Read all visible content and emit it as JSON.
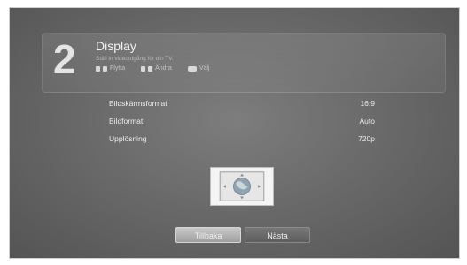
{
  "header": {
    "step_number": "2",
    "title": "Display",
    "subtitle": "Ställ in videoutgång för din TV.",
    "hints": {
      "move_label": "Flytta",
      "change_label": "Ändra",
      "select_label": "Välj"
    }
  },
  "settings": [
    {
      "label": "Bildskärmsformat",
      "value": "16:9"
    },
    {
      "label": "Bildformat",
      "value": "Auto"
    },
    {
      "label": "Upplösning",
      "value": "720p"
    }
  ],
  "preview": {
    "icon": "globe-icon"
  },
  "buttons": {
    "back_label": "Tillbaka",
    "next_label": "Nästa",
    "focused": "back"
  }
}
